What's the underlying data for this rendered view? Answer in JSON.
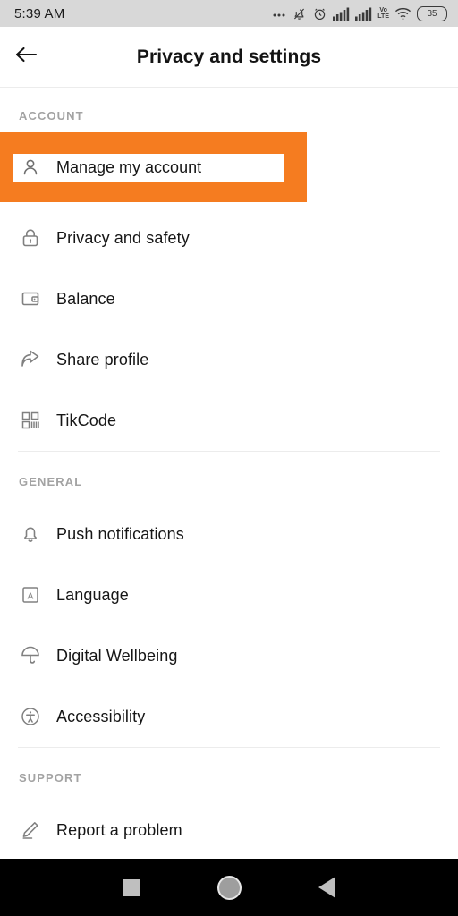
{
  "statusbar": {
    "time": "5:39 AM",
    "battery_level": "35",
    "network_label": "Vo\nLTE",
    "network_line1": "Vo",
    "network_line2": "LTE",
    "icons": [
      "ellipsis-icon",
      "bell-muted-icon",
      "alarm-clock-icon",
      "signal-bars-icon",
      "signal-bars-icon",
      "volte-icon",
      "wifi-icon",
      "battery-icon"
    ]
  },
  "header": {
    "back_icon": "back-arrow-icon",
    "title": "Privacy and settings"
  },
  "sections": [
    {
      "label": "ACCOUNT",
      "items": [
        {
          "label": "Manage my account",
          "icon": "person-icon",
          "highlighted": true
        },
        {
          "label": "Privacy and safety",
          "icon": "lock-icon"
        },
        {
          "label": "Balance",
          "icon": "wallet-icon"
        },
        {
          "label": "Share profile",
          "icon": "share-arrow-icon"
        },
        {
          "label": "TikCode",
          "icon": "qr-code-icon"
        }
      ]
    },
    {
      "label": "GENERAL",
      "items": [
        {
          "label": "Push notifications",
          "icon": "bell-icon"
        },
        {
          "label": "Language",
          "icon": "letter-a-box-icon"
        },
        {
          "label": "Digital Wellbeing",
          "icon": "umbrella-icon"
        },
        {
          "label": "Accessibility",
          "icon": "accessibility-icon"
        }
      ]
    },
    {
      "label": "SUPPORT",
      "items": [
        {
          "label": "Report a problem",
          "icon": "pencil-icon"
        }
      ]
    }
  ],
  "navbar": {
    "recents": "recents-square",
    "home": "home-circle",
    "back": "back-triangle"
  },
  "colors": {
    "highlight_orange": "#f57c20",
    "statusbar_bg": "#d8d8d8",
    "text_primary": "#161616",
    "text_muted": "#a3a3a3",
    "icon_gray": "#808080"
  }
}
